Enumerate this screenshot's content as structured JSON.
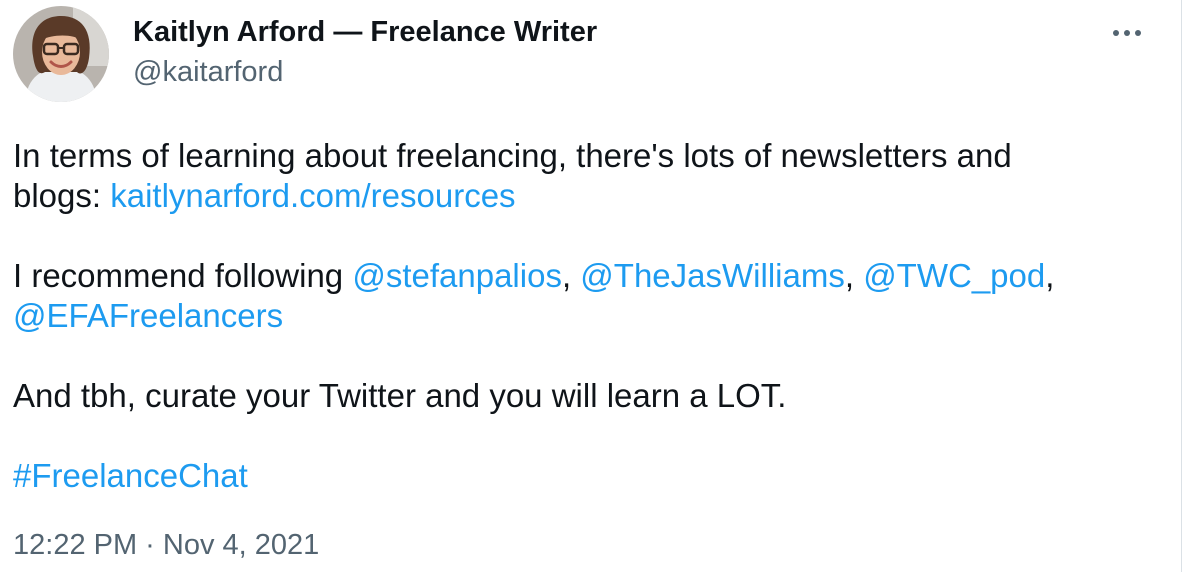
{
  "author": {
    "display_name": "Kaitlyn Arford — Freelance Writer",
    "handle": "@kaitarford"
  },
  "tweet": {
    "line1": "In terms of learning about freelancing, there's lots of newsletters and",
    "line2_prefix": "blogs: ",
    "resources_link": "kaitlynarford.com/resources",
    "recommend_prefix": "I recommend following ",
    "mentions": [
      "@stefanpalios",
      "@TheJasWilliams",
      "@TWC_pod",
      "@EFAFreelancers"
    ],
    "separator": ", ",
    "closing_line": "And tbh, curate your Twitter and you will learn a LOT.",
    "hashtag": "#FreelanceChat"
  },
  "timestamp": "12:22 PM · Nov 4, 2021",
  "colors": {
    "link": "#1d9bf0",
    "secondary_text": "#536471",
    "primary_text": "#0f1419"
  }
}
